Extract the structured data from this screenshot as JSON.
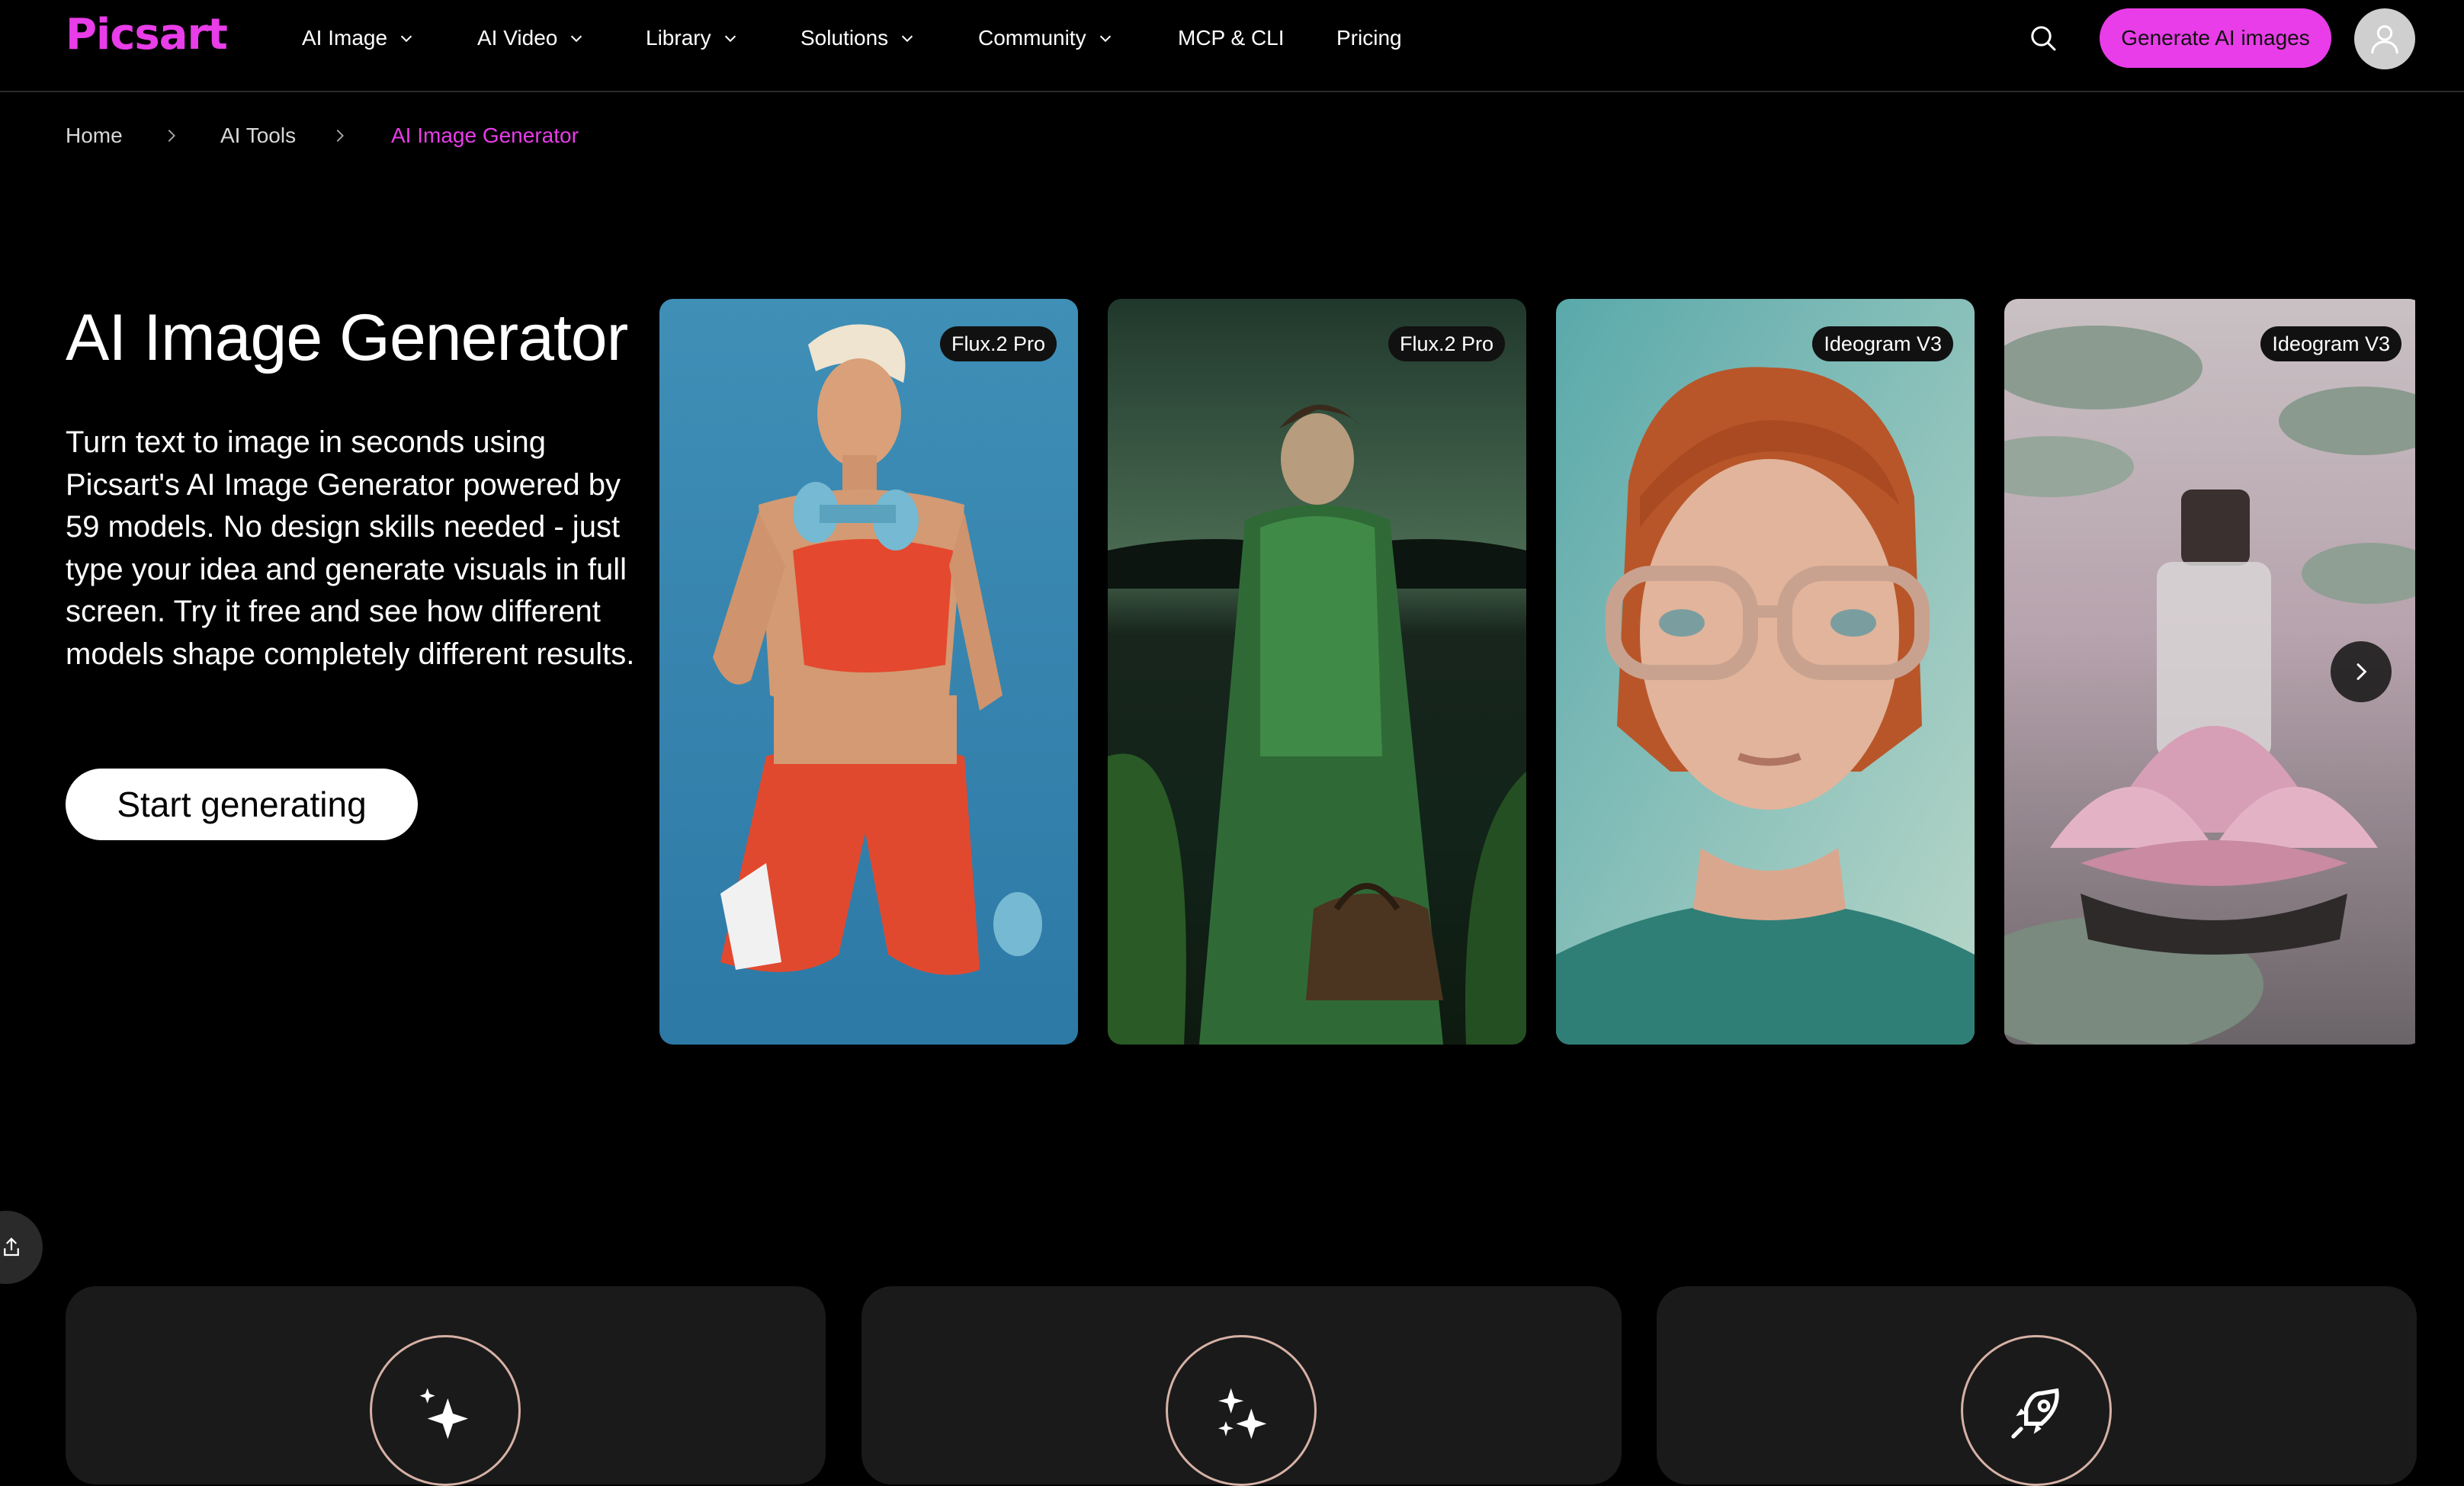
{
  "brand": {
    "logo_text": "Picsart",
    "accent_color": "#e83de8"
  },
  "nav": {
    "items": [
      {
        "label": "AI Image",
        "has_dropdown": true
      },
      {
        "label": "AI Video",
        "has_dropdown": true
      },
      {
        "label": "Library",
        "has_dropdown": true
      },
      {
        "label": "Solutions",
        "has_dropdown": true
      },
      {
        "label": "Community",
        "has_dropdown": true
      },
      {
        "label": "MCP & CLI",
        "has_dropdown": false
      },
      {
        "label": "Pricing",
        "has_dropdown": false
      }
    ],
    "search_icon": "search-icon",
    "cta_label": "Generate AI images",
    "avatar_icon": "user-icon"
  },
  "breadcrumb": {
    "items": [
      "Home",
      "AI Tools",
      "AI Image Generator"
    ]
  },
  "hero": {
    "title": "AI Image Generator",
    "description": "Turn text to image in seconds using Picsart's AI Image Generator powered by 59 models. No design skills needed - just type your idea and generate visuals in full screen. Try it free and see how different models shape completely different results.",
    "cta_label": "Start generating"
  },
  "carousel": {
    "cards": [
      {
        "model": "Flux.2 Pro",
        "subject": "athletic woman with dumbbells"
      },
      {
        "model": "Flux.2 Pro",
        "subject": "man in green robe by lake"
      },
      {
        "model": "Ideogram V3",
        "subject": "red-haired man with glasses"
      },
      {
        "model": "Ideogram V3",
        "subject": "perfume bottle on lotus flower"
      }
    ],
    "next_icon": "chevron-right-icon"
  },
  "share_icon": "share-icon",
  "features": [
    {
      "icon": "sparkle-icon"
    },
    {
      "icon": "sparkles-icon"
    },
    {
      "icon": "rocket-icon"
    }
  ]
}
